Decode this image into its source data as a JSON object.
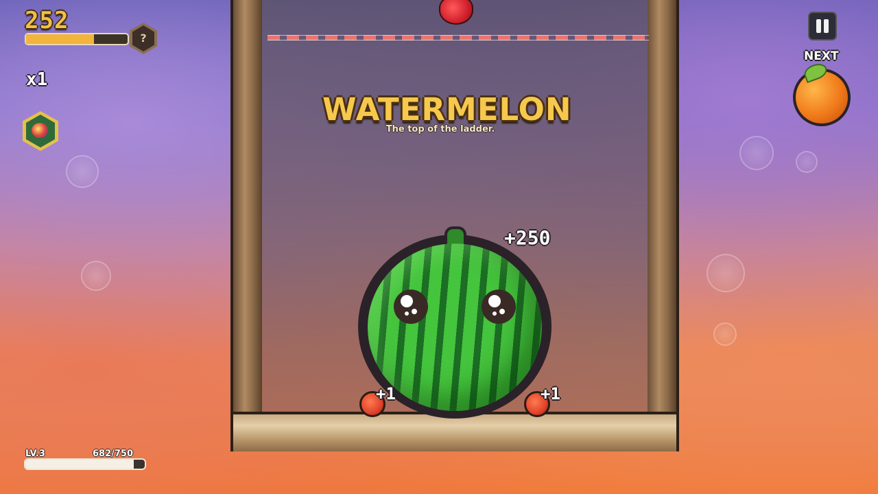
{
  "hud": {
    "score": "252",
    "score_progress": 0.67,
    "mystery_badge": "?",
    "multiplier": "x1",
    "level_label": "LV.3",
    "xp_text": "682/750",
    "xp_progress": 0.909
  },
  "next": {
    "label": "NEXT",
    "fruit": "orange-icon"
  },
  "banner": {
    "title": "WATERMELON",
    "subtitle": "The top of the ladder."
  },
  "popups": {
    "main": "+250",
    "left": "+1",
    "right": "+1"
  },
  "icons": {
    "pause": "pause-icon",
    "gem": "gem-icon",
    "falling_fruit": "strawberry-icon",
    "merged_fruit": "watermelon-icon"
  },
  "colors": {
    "score_gold": "#f3bf45",
    "title_gold": "#f6c84d",
    "danger_line": "#e9756f"
  }
}
